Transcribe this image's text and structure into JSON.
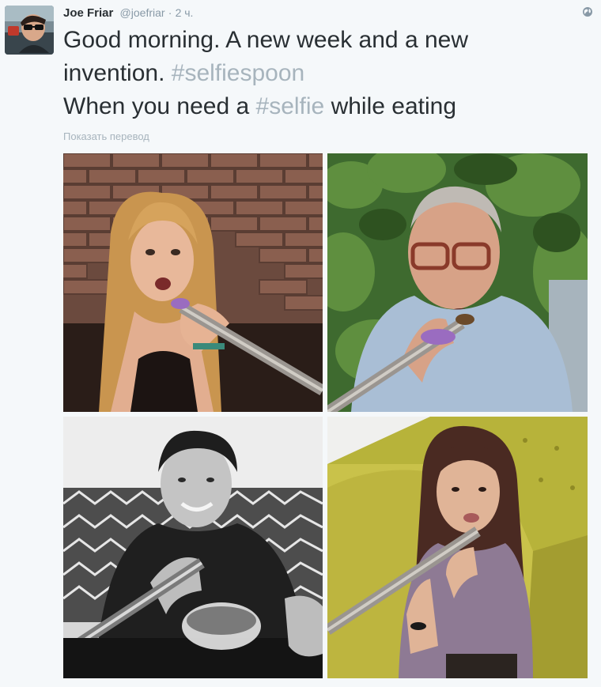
{
  "tweet": {
    "author_name": "Joe Friar",
    "handle": "@joefriar",
    "separator": "·",
    "time": "2 ч.",
    "text_line1": "Good morning.  A new week and a new",
    "text_line2_plain": "invention. ",
    "hashtag1": "#selfiespoon",
    "text_line3_plain": "When you need a ",
    "hashtag2": "#selfie",
    "text_line3_end": " while eating",
    "translate_link": "Показать перевод"
  },
  "icons": {
    "globe": "globe-icon",
    "avatar": "avatar"
  },
  "colors": {
    "background": "#f5f8fa",
    "hashtag": "#a7b4bd",
    "meta": "#8899a6"
  },
  "photos": [
    {
      "name": "photo-woman-brick-wall"
    },
    {
      "name": "photo-man-glasses-plants"
    },
    {
      "name": "photo-man-black-white-cereal"
    },
    {
      "name": "photo-woman-yellow-sofa"
    }
  ]
}
